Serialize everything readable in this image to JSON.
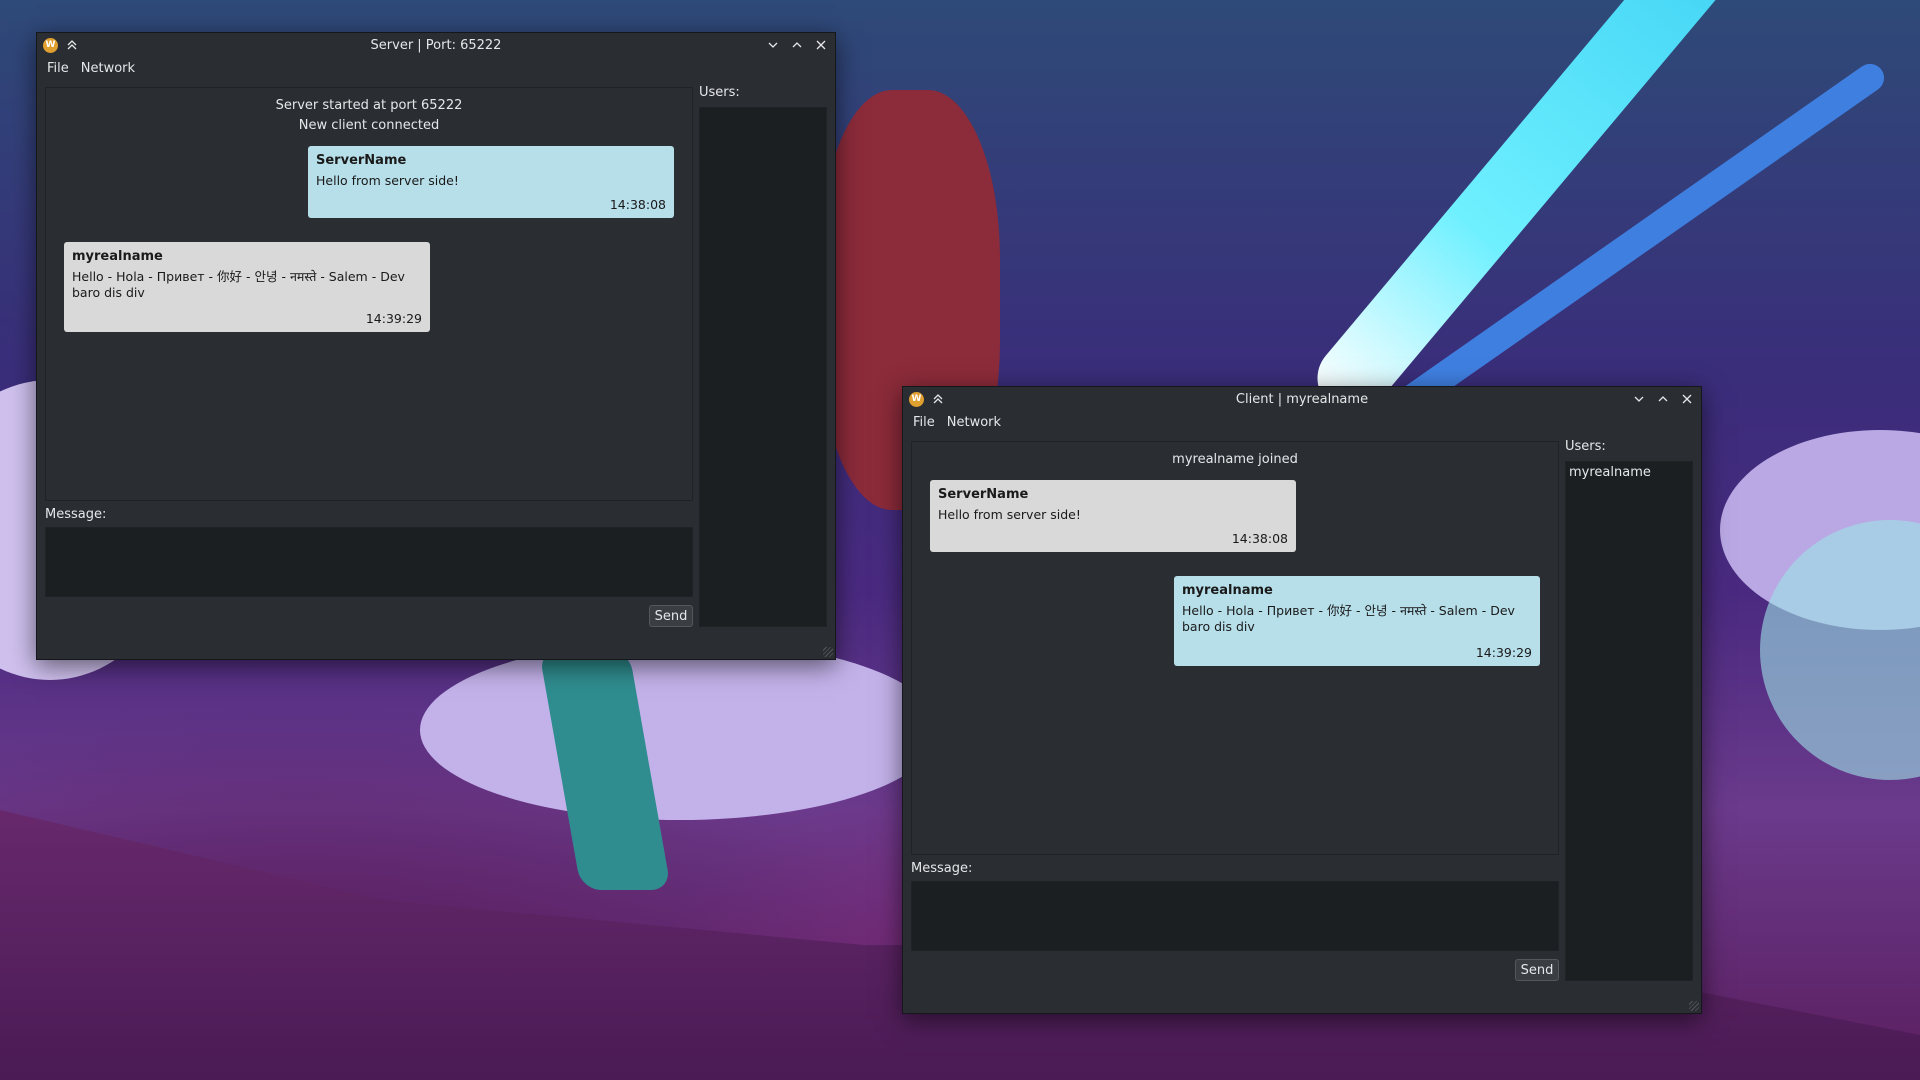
{
  "server_window": {
    "title": "Server | Port: 65222",
    "menu": [
      "File",
      "Network"
    ],
    "system_lines": [
      "Server started at port 65222",
      "New client connected"
    ],
    "messages": [
      {
        "sender": "ServerName",
        "text": "Hello from server side!",
        "time": "14:38:08",
        "kind": "sent"
      },
      {
        "sender": "myrealname",
        "text": "Hello - Hola - Привет - 你好 - 안녕 - नमस्ते  - Salem - Dev baro dis div",
        "time": "14:39:29",
        "kind": "received"
      }
    ],
    "message_label": "Message:",
    "message_value": "",
    "send_label": "Send",
    "users_label": "Users:",
    "users": []
  },
  "client_window": {
    "title": "Client | myrealname",
    "menu": [
      "File",
      "Network"
    ],
    "system_lines": [
      "myrealname joined"
    ],
    "messages": [
      {
        "sender": "ServerName",
        "text": "Hello from server side!",
        "time": "14:38:08",
        "kind": "received"
      },
      {
        "sender": "myrealname",
        "text": "Hello - Hola - Привет - 你好 - 안녕 - नमस्ते  - Salem - Dev baro dis div",
        "time": "14:39:29",
        "kind": "sent"
      }
    ],
    "message_label": "Message:",
    "message_value": "",
    "send_label": "Send",
    "users_label": "Users:",
    "users": [
      "myrealname"
    ]
  },
  "colors": {
    "sent_bubble": "#b7dfea",
    "received_bubble": "#d9d9d9",
    "window_bg": "#2a2e32",
    "input_bg": "#1c1f22",
    "app_icon": "#e0a030"
  }
}
